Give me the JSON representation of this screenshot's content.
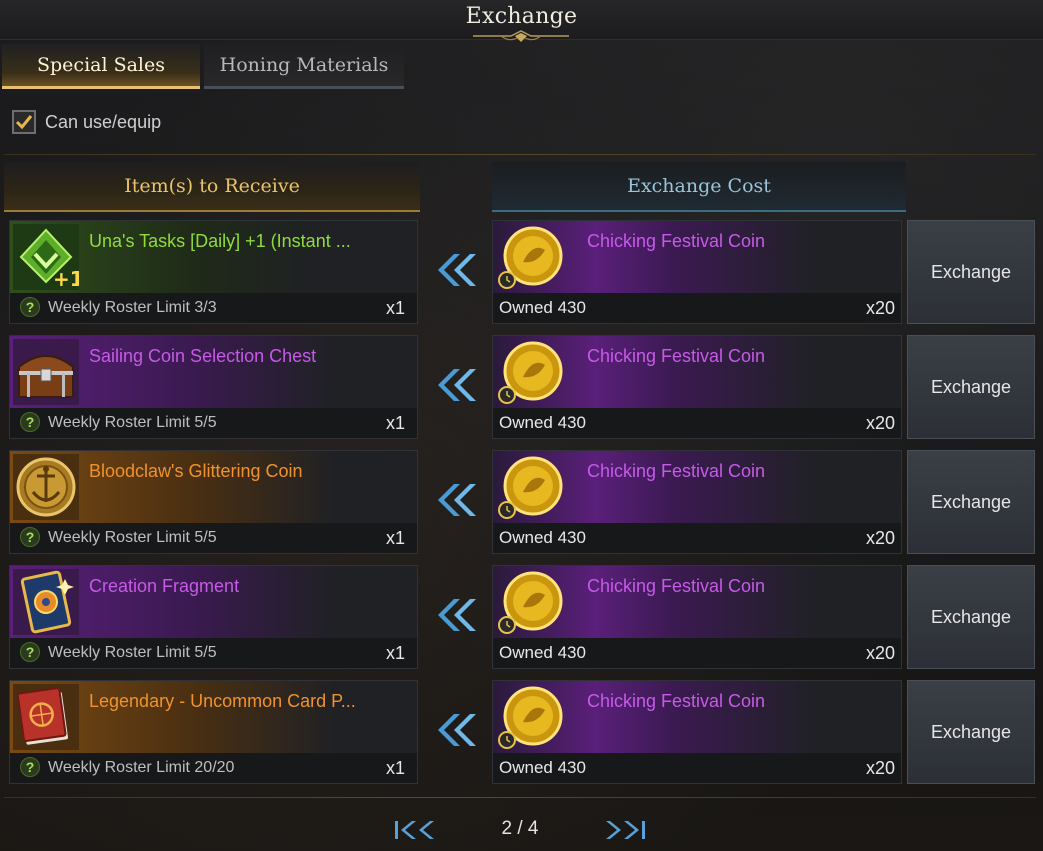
{
  "window": {
    "title": "Exchange"
  },
  "tabs": [
    {
      "label": "Special Sales",
      "active": true
    },
    {
      "label": "Honing Materials",
      "active": false
    }
  ],
  "filter": {
    "label": "Can use/equip",
    "checked": true
  },
  "columns": {
    "receive": "Item(s) to Receive",
    "cost": "Exchange Cost"
  },
  "rows": [
    {
      "name": "Una's Tasks [Daily] +1 (Instant ...",
      "grade": "green",
      "icon": "una-task-icon",
      "limit": "Weekly Roster Limit 3/3",
      "qty": "x1",
      "cost_name": "Chicking Festival Coin",
      "owned": "Owned 430",
      "cost_qty": "x20",
      "button": "Exchange"
    },
    {
      "name": "Sailing Coin Selection Chest",
      "grade": "purple",
      "icon": "treasure-chest-icon",
      "limit": "Weekly Roster Limit 5/5",
      "qty": "x1",
      "cost_name": "Chicking Festival Coin",
      "owned": "Owned 430",
      "cost_qty": "x20",
      "button": "Exchange"
    },
    {
      "name": "Bloodclaw's Glittering Coin",
      "grade": "orange",
      "icon": "anchor-coin-icon",
      "limit": "Weekly Roster Limit 5/5",
      "qty": "x1",
      "cost_name": "Chicking Festival Coin",
      "owned": "Owned 430",
      "cost_qty": "x20",
      "button": "Exchange"
    },
    {
      "name": "Creation Fragment",
      "grade": "purple",
      "icon": "card-fragment-icon",
      "limit": "Weekly Roster Limit 5/5",
      "qty": "x1",
      "cost_name": "Chicking Festival Coin",
      "owned": "Owned 430",
      "cost_qty": "x20",
      "button": "Exchange"
    },
    {
      "name": "Legendary - Uncommon Card P...",
      "grade": "orange",
      "icon": "card-pack-book-icon",
      "limit": "Weekly Roster Limit 20/20",
      "qty": "x1",
      "cost_name": "Chicking Festival Coin",
      "owned": "Owned 430",
      "cost_qty": "x20",
      "button": "Exchange"
    }
  ],
  "pager": {
    "text": "2 / 4"
  },
  "colors": {
    "accent_gold": "#e9c46a",
    "accent_blue": "#9cc3d6",
    "grade_green": "#8fdc3a",
    "grade_purple": "#c75ae8",
    "grade_orange": "#f0922e"
  }
}
